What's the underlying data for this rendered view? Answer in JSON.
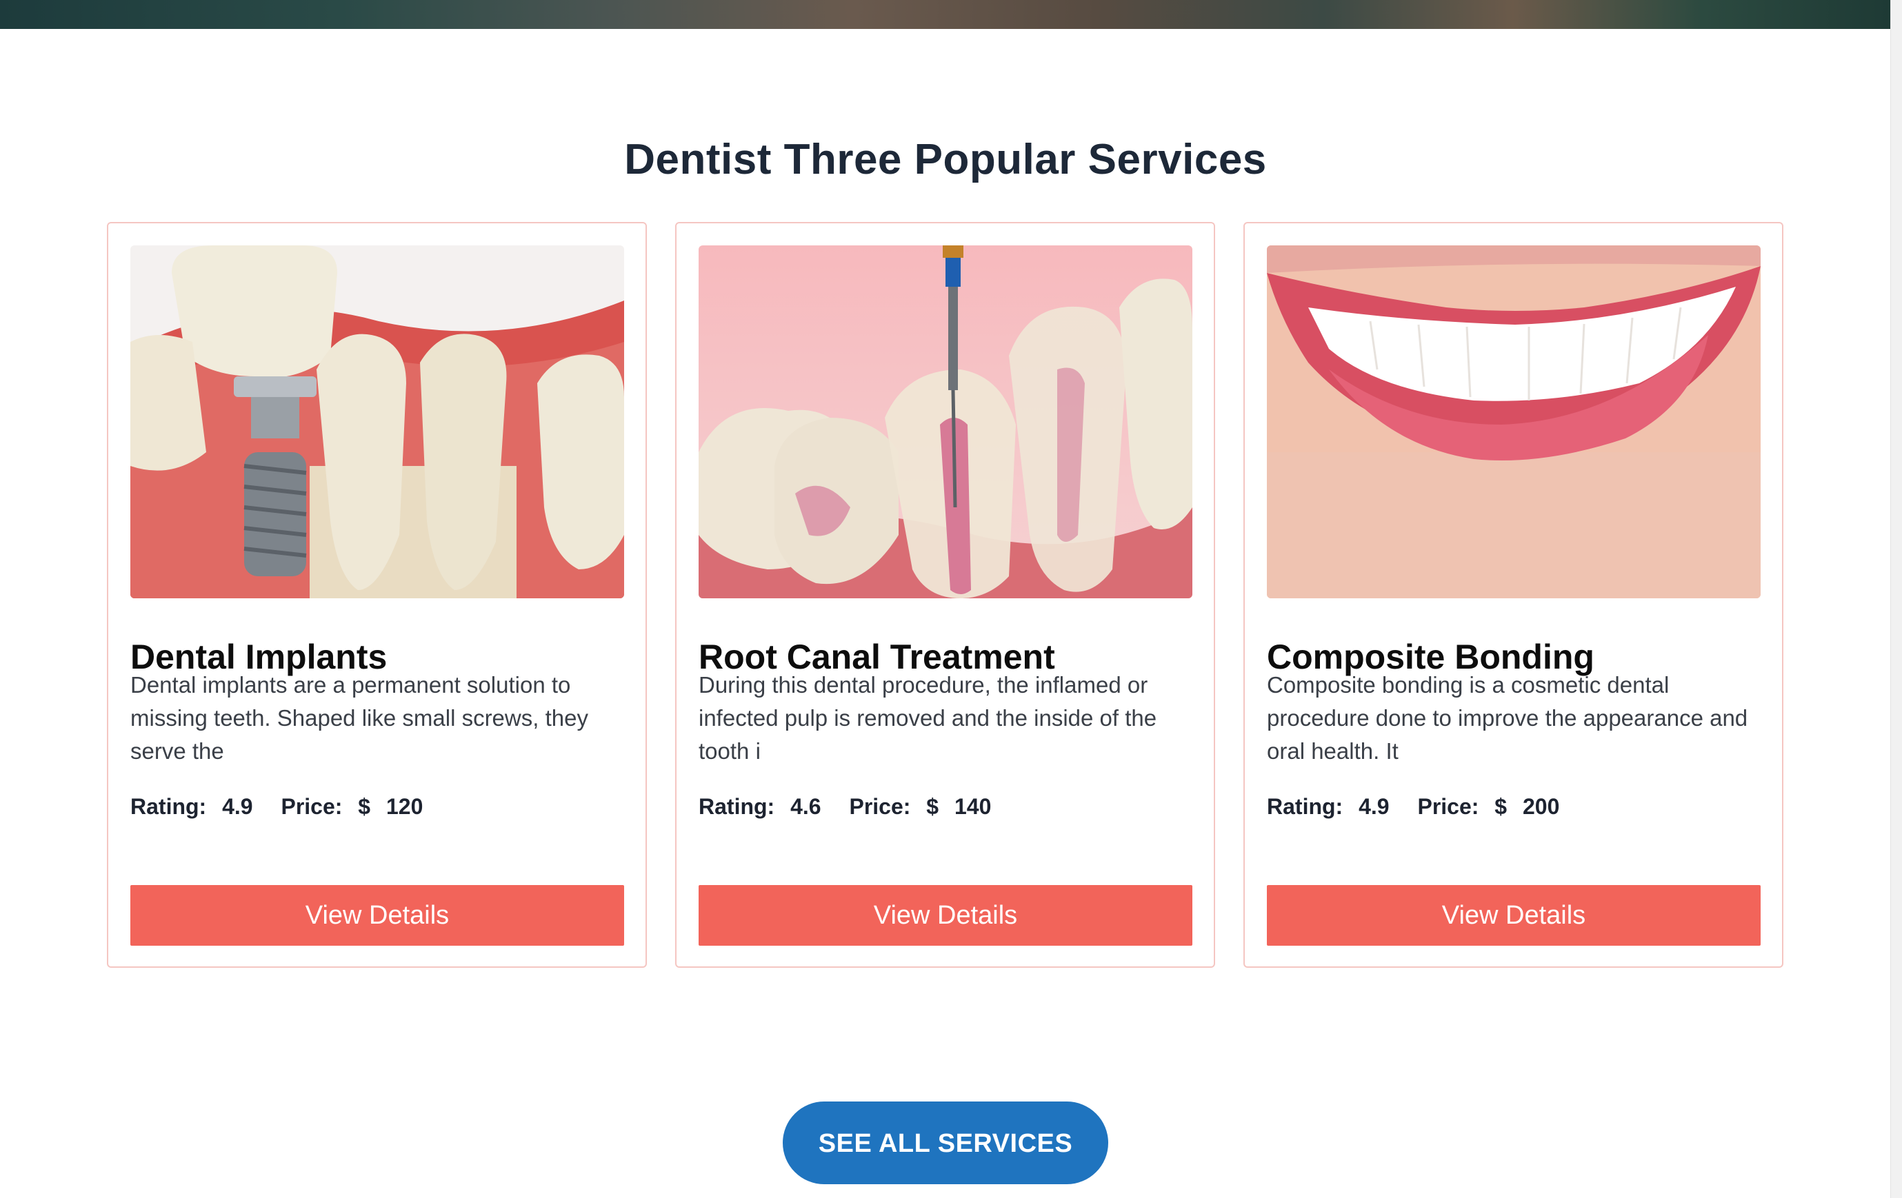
{
  "section": {
    "title": "Dentist Three Popular Services"
  },
  "services": [
    {
      "title": "Dental Implants",
      "description": "Dental implants are a permanent solution to missing teeth. Shaped like small screws, they serve the",
      "rating_label": "Rating:",
      "rating": "4.9",
      "price_label": "Price:",
      "currency": "$",
      "price": "120",
      "button_label": "View Details",
      "image_icon": "dental-implant-image"
    },
    {
      "title": "Root Canal Treatment",
      "description": "During this dental procedure, the inflamed or infected pulp is removed and the inside of the tooth i",
      "rating_label": "Rating:",
      "rating": "4.6",
      "price_label": "Price:",
      "currency": "$",
      "price": "140",
      "button_label": "View Details",
      "image_icon": "root-canal-image"
    },
    {
      "title": "Composite Bonding",
      "description": "Composite bonding is a cosmetic dental procedure done to improve the appearance and oral health. It",
      "rating_label": "Rating:",
      "rating": "4.9",
      "price_label": "Price:",
      "currency": "$",
      "price": "200",
      "button_label": "View Details",
      "image_icon": "smile-image"
    }
  ],
  "see_all": {
    "label": "SEE ALL SERVICES"
  },
  "colors": {
    "accent_button": "#f2645a",
    "primary_button": "#1f74bf",
    "card_border": "#f5c6c2",
    "heading": "#1d2838"
  }
}
